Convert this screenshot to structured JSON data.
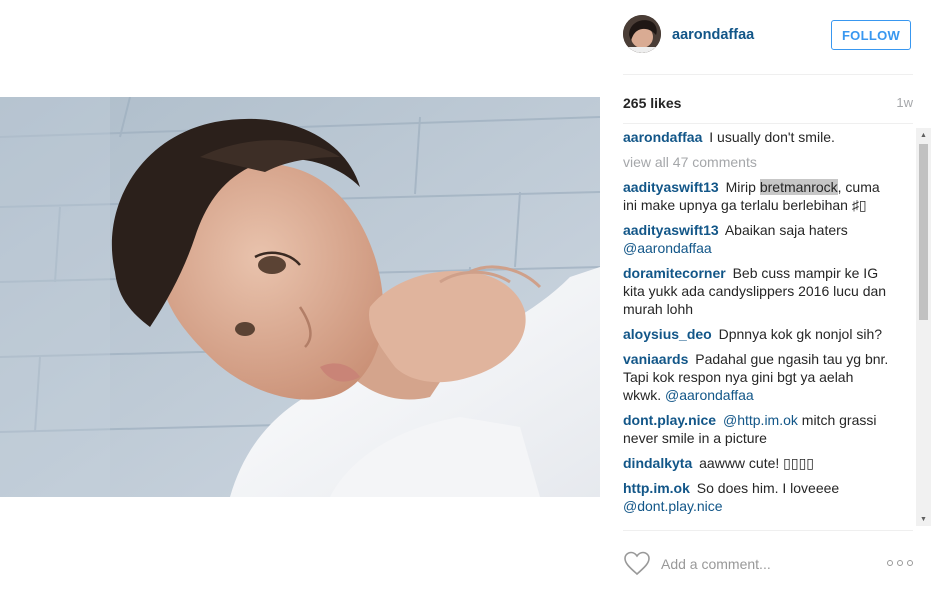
{
  "post": {
    "username": "aarondaffaa",
    "follow_label": "FOLLOW",
    "likes": "265 likes",
    "time": "1w",
    "caption": {
      "user": "aarondaffaa",
      "text": "I usually don't smile."
    },
    "view_all": "view all 47 comments"
  },
  "comments": [
    {
      "user": "aadityaswift13",
      "pre": "Mirip ",
      "highlight": "bretmanrock",
      "post": ", cuma ini make upnya ga terlalu berlebihan ♯▯",
      "mention": ""
    },
    {
      "user": "aadityaswift13",
      "pre": "Abaikan saja haters ",
      "highlight": "",
      "post": "",
      "mention": "@aarondaffaa"
    },
    {
      "user": "doramitecorner",
      "pre": "Beb cuss mampir ke IG kita yukk ada candyslippers 2016 lucu dan murah lohh",
      "highlight": "",
      "post": "",
      "mention": ""
    },
    {
      "user": "aloysius_deo",
      "pre": "Dpnnya kok gk nonjol sih?",
      "highlight": "",
      "post": "",
      "mention": ""
    },
    {
      "user": "vaniaards",
      "pre": "Padahal gue ngasih tau yg bnr. Tapi kok respon nya gini bgt ya aelah wkwk. ",
      "highlight": "",
      "post": "",
      "mention": "@aarondaffaa"
    },
    {
      "user": "dont.play.nice",
      "pre": "",
      "highlight": "",
      "post": "",
      "mention": "@http.im.ok",
      "after_mention": " mitch grassi never smile in a picture"
    },
    {
      "user": "dindalkyta",
      "pre": "aawww cute! ▯▯▯▯",
      "highlight": "",
      "post": "",
      "mention": ""
    },
    {
      "user": "http.im.ok",
      "pre": "So does him. I loveeee ",
      "highlight": "",
      "post": "",
      "mention": "@dont.play.nice"
    }
  ],
  "footer": {
    "comment_placeholder": "Add a comment...",
    "heart_icon": "heart-outline-icon",
    "more_icon": "more-options-icon"
  },
  "colors": {
    "username": "#125688",
    "follow": "#3897f0",
    "muted": "#a5a7aa"
  }
}
